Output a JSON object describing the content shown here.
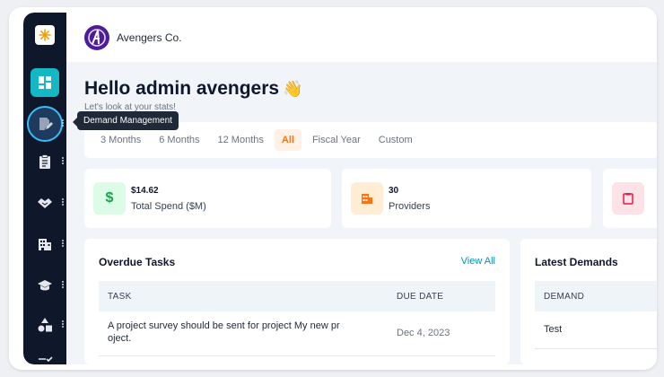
{
  "sidebar": {
    "logo_icon": "asterisk-logo-icon",
    "items": [
      {
        "icon": "dashboard-grid-icon",
        "active": true
      },
      {
        "icon": "edit-document-icon",
        "tooltip": "Demand Management",
        "hovered": true
      },
      {
        "icon": "clipboard-icon"
      },
      {
        "icon": "handshake-icon"
      },
      {
        "icon": "building-icon"
      },
      {
        "icon": "graduation-cap-icon"
      },
      {
        "icon": "shapes-icon"
      },
      {
        "icon": "checklist-icon"
      }
    ],
    "tooltip": "Demand Management"
  },
  "header": {
    "brand_name": "Avengers Co.",
    "brand_logo": "avengers-logo-icon"
  },
  "greeting": {
    "title": "Hello admin avengers",
    "emoji": "👋",
    "subtitle": "Let's look at your stats!"
  },
  "filters": {
    "options": [
      "3 Months",
      "6 Months",
      "12 Months",
      "All",
      "Fiscal Year",
      "Custom"
    ],
    "selected": "All"
  },
  "stats": [
    {
      "value": "$14.62",
      "label": "Total Spend ($M)",
      "icon": "dollar-icon",
      "icon_bg": "#dcfce7",
      "icon_color": "#16a34a"
    },
    {
      "value": "30",
      "label": "Providers",
      "icon": "building-icon",
      "icon_bg": "#ffedd5",
      "icon_color": "#f97316"
    },
    {
      "value": "",
      "label": "",
      "icon": "clipboard-icon",
      "icon_bg": "#fde2e7",
      "icon_color": "#e11d48"
    }
  ],
  "overdue_tasks": {
    "title": "Overdue Tasks",
    "view_all": "View All",
    "columns": [
      "TASK",
      "DUE DATE"
    ],
    "rows": [
      {
        "task": "A project survey should be sent for project My new pr oject.",
        "due": "Dec 4, 2023"
      }
    ]
  },
  "latest_demands": {
    "title": "Latest Demands",
    "columns": [
      "DEMAND"
    ],
    "rows": [
      {
        "demand": "Test"
      }
    ]
  },
  "colors": {
    "accent": "#14b8c4",
    "orange": "#f97316",
    "sidebar_bg": "#0f172a",
    "link": "#0891b2"
  }
}
